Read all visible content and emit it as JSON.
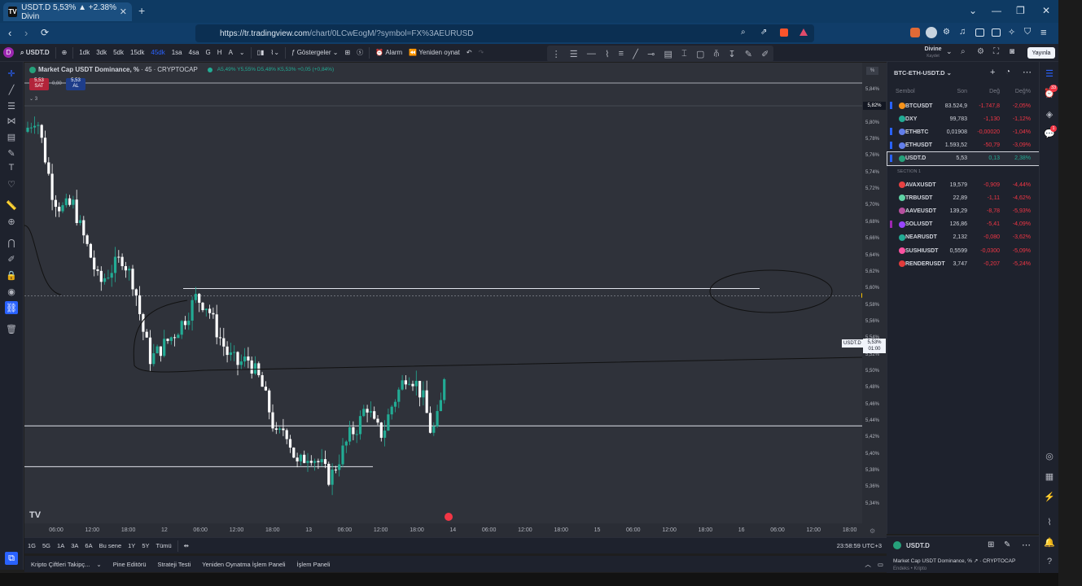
{
  "browser": {
    "tab_title": "USDT.D 5,53% ▲ +2.38% Divin",
    "tab_close": "✕",
    "new_tab": "+",
    "url_host": "https://tr.tradingview.com",
    "url_path": "/chart/0LCwEogM/?symbol=FX%3AEURUSD",
    "win_min": "—",
    "win_max": "❐",
    "win_close": "✕",
    "chevron": "⌄"
  },
  "toolbar": {
    "avatar": "D",
    "symbol": "USDT.D",
    "intervals": [
      "1dk",
      "3dk",
      "5dk",
      "15dk",
      "45dk",
      "1sa",
      "4sa",
      "G",
      "H",
      "A"
    ],
    "active_interval": "45dk",
    "indicators": "Göstergeler",
    "alarm": "Alarm",
    "replay": "Yeniden oynat",
    "layout_name": "Divine",
    "layout_sub": "Kaydet",
    "publish": "Yayınla"
  },
  "legend": {
    "title": "Market Cap USDT Dominance, %",
    "interval": "45",
    "source": "CRYPTOCAP",
    "ohlc": "A5,49% Y5,55% D5,48% K5,53% +0,05 (+0,84%)",
    "sell_price": "5,53",
    "sell_label": "SAT",
    "spread": "0,00",
    "buy_price": "5,53",
    "buy_label": "AL",
    "indicator_count": "3"
  },
  "price_axis": {
    "unit": "%",
    "ticks": [
      "5,84%",
      "5,82%",
      "5,80%",
      "5,78%",
      "5,76%",
      "5,74%",
      "5,72%",
      "5,70%",
      "5,68%",
      "5,66%",
      "5,64%",
      "5,62%",
      "5,60%",
      "5,58%",
      "5,56%",
      "5,54%",
      "5,52%",
      "5,50%",
      "5,48%",
      "5,46%",
      "5,44%",
      "5,42%",
      "5,40%",
      "5,38%",
      "5,36%",
      "5,34%"
    ],
    "marker_top": "5,82%",
    "current_symbol": "USDT.D",
    "current_price": "5,53%",
    "countdown": "01:00"
  },
  "time_axis": {
    "ticks": [
      "06:00",
      "12:00",
      "18:00",
      "12",
      "06:00",
      "12:00",
      "18:00",
      "13",
      "06:00",
      "12:00",
      "18:00",
      "14",
      "06:00",
      "12:00",
      "18:00",
      "15",
      "06:00",
      "12:00",
      "18:00",
      "16",
      "06:00",
      "12:00",
      "18:00"
    ]
  },
  "range_bar": {
    "ranges": [
      "1G",
      "5G",
      "1A",
      "3A",
      "6A",
      "Bu sene",
      "1Y",
      "5Y",
      "Tümü"
    ],
    "clock": "23:58:59 UTC+3"
  },
  "bottom_panel": {
    "tabs": [
      "Kripto Çiftleri Takipç...",
      "Pine Editörü",
      "Strateji Testi",
      "Yeniden Oynatma İşlem Paneli",
      "İşlem Paneli"
    ]
  },
  "watchlist": {
    "name": "BTC-ETH-USDT.D",
    "col_symbol": "Sembol",
    "col_last": "Son",
    "col_chg": "Değ",
    "col_pct": "Değ%",
    "section": "SECTION 1",
    "rows": [
      {
        "symbol": "BTCUSDT",
        "last": "83.524,9",
        "chg": "-1.747,8",
        "pct": "-2,05%",
        "color": "#f7931a",
        "flag": "#2962ff"
      },
      {
        "symbol": "DXY",
        "last": "99,783",
        "chg": "-1,130",
        "pct": "-1,12%",
        "color": "#22ab94",
        "flag": ""
      },
      {
        "symbol": "ETHBTC",
        "last": "0,01908",
        "chg": "-0,00020",
        "pct": "-1,04%",
        "color": "#627eea",
        "flag": "#2962ff"
      },
      {
        "symbol": "ETHUSDT",
        "last": "1.593,52",
        "chg": "-50,79",
        "pct": "-3,09%",
        "color": "#627eea",
        "flag": "#2962ff"
      },
      {
        "symbol": "USDT.D",
        "last": "5,53",
        "chg": "0,13",
        "pct": "2,38%",
        "color": "#26a17b",
        "flag": "#2962ff"
      },
      {
        "symbol": "AVAXUSDT",
        "last": "19,579",
        "chg": "-0,909",
        "pct": "-4,44%",
        "color": "#e84142",
        "flag": ""
      },
      {
        "symbol": "TRBUSDT",
        "last": "22,89",
        "chg": "-1,11",
        "pct": "-4,62%",
        "color": "#5fd3a5",
        "flag": ""
      },
      {
        "symbol": "AAVEUSDT",
        "last": "139,29",
        "chg": "-8,78",
        "pct": "-5,93%",
        "color": "#b6509e",
        "flag": ""
      },
      {
        "symbol": "SOLUSDT",
        "last": "126,86",
        "chg": "-5,41",
        "pct": "-4,09%",
        "color": "#9945ff",
        "flag": "#9c27b0"
      },
      {
        "symbol": "NEARUSDT",
        "last": "2,132",
        "chg": "-0,080",
        "pct": "-3,62%",
        "color": "#22ab94",
        "flag": ""
      },
      {
        "symbol": "SUSHIUSDT",
        "last": "0,5599",
        "chg": "-0,0300",
        "pct": "-5,09%",
        "color": "#fa52a0",
        "flag": ""
      },
      {
        "symbol": "RENDERUSDT",
        "last": "3,747",
        "chg": "-0,207",
        "pct": "-5,24%",
        "color": "#e23b3b",
        "flag": ""
      }
    ]
  },
  "details": {
    "symbol": "USDT.D",
    "description": "Market Cap USDT Dominance, %",
    "source": "CRYPTOCAP",
    "meta": "Endeks • Kripto"
  },
  "notifications": {
    "alerts_count": "33",
    "chat_count": "1"
  },
  "chart_data": {
    "type": "candlestick",
    "title": "Market Cap USDT Dominance, %",
    "ylim": [
      5.33,
      5.85
    ],
    "price_range": {
      "low": 5.37,
      "high": 5.82
    },
    "last": 5.53,
    "horizontal_levels": [
      5.595,
      5.44,
      5.394
    ],
    "colors": {
      "up": "#22ab94",
      "down": "#ffffff",
      "background": "#2f323a"
    }
  }
}
